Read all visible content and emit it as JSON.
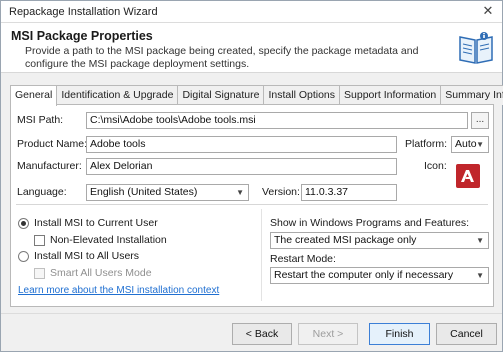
{
  "window": {
    "title": "Repackage Installation Wizard",
    "close_glyph": "✕"
  },
  "header": {
    "title": "MSI Package Properties",
    "description": "Provide a path to the MSI package being created, specify the package metadata and configure the MSI package deployment settings.",
    "icon": "book-icon"
  },
  "tabs": [
    {
      "label": "General",
      "active": true
    },
    {
      "label": "Identification & Upgrade"
    },
    {
      "label": "Digital Signature"
    },
    {
      "label": "Install Options"
    },
    {
      "label": "Support Information"
    },
    {
      "label": "Summary Info"
    }
  ],
  "form": {
    "msi_path_label": "MSI Path:",
    "msi_path_value": "C:\\msi\\Adobe tools\\Adobe tools.msi",
    "browse_label": "...",
    "product_name_label": "Product Name:",
    "product_name_value": "Adobe tools",
    "platform_label": "Platform:",
    "platform_value": "Auto",
    "manufacturer_label": "Manufacturer:",
    "manufacturer_value": "Alex Delorian",
    "icon_label": "Icon:",
    "language_label": "Language:",
    "language_value": "English (United States)",
    "version_label": "Version:",
    "version_value": "11.0.3.37"
  },
  "install": {
    "current_user_label": "Install MSI to Current User",
    "non_elevated_label": "Non-Elevated Installation",
    "all_users_label": "Install MSI to All Users",
    "smart_all_users_label": "Smart All Users Mode",
    "learn_more_link": "Learn more about the MSI installation context"
  },
  "right": {
    "show_label": "Show in Windows Programs and Features:",
    "show_value": "The created MSI package only",
    "restart_label": "Restart Mode:",
    "restart_value": "Restart the computer only if necessary"
  },
  "footer": {
    "back": "< Back",
    "next": "Next >",
    "finish": "Finish",
    "cancel": "Cancel"
  },
  "colors": {
    "accent": "#3c7fd6",
    "link": "#1f6fd1",
    "icon_red": "#c0262b"
  }
}
